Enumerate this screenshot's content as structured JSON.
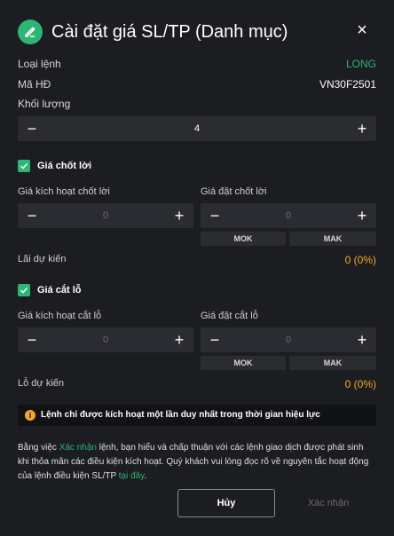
{
  "header": {
    "title": "Cài đặt giá SL/TP (Danh mục)",
    "close": "×"
  },
  "info": {
    "order_type_label": "Loại lệnh",
    "order_type_value": "LONG",
    "contract_label": "Mã HĐ",
    "contract_value": "VN30F2501",
    "volume_label": "Khối lượng",
    "volume_value": "4"
  },
  "take_profit": {
    "checkbox_label": "Giá chốt lời",
    "trigger_label": "Giá kích hoạt chốt lời",
    "order_label": "Giá đặt chốt lời",
    "trigger_value": "0",
    "order_value": "0",
    "mok_label": "MOK",
    "mak_label": "MAK",
    "expected_label": "Lãi dự kiến",
    "expected_value": "0 (0%)"
  },
  "stop_loss": {
    "checkbox_label": "Giá cắt lỗ",
    "trigger_label": "Giá kích hoạt cắt lỗ",
    "order_label": "Giá đặt cắt lỗ",
    "trigger_value": "0",
    "order_value": "0",
    "mok_label": "MOK",
    "mak_label": "MAK",
    "expected_label": "Lỗ dự kiến",
    "expected_value": "0 (0%)"
  },
  "notice": {
    "icon": "i",
    "text": "Lệnh chỉ được kích hoạt một lần duy nhất trong thời gian hiệu lực"
  },
  "disclaimer": {
    "part1": "Bằng việc ",
    "link1": "Xác nhận",
    "part2": " lệnh, bạn hiểu và chấp thuận với các lệnh giao dịch được phát sinh khi thỏa mãn các điều kiện kích hoạt. Quý khách vui lòng đọc rõ về nguyên tắc hoạt động của lệnh điều kiện SL/TP ",
    "link2": "tại đây",
    "part3": "."
  },
  "buttons": {
    "cancel": "Hủy",
    "confirm": "Xác nhận"
  },
  "stepper_symbols": {
    "minus": "−",
    "plus": "+"
  },
  "colors": {
    "accent": "#2bb673",
    "warning": "#f5a623",
    "background": "#1c1d21",
    "field": "#2b2c31"
  }
}
